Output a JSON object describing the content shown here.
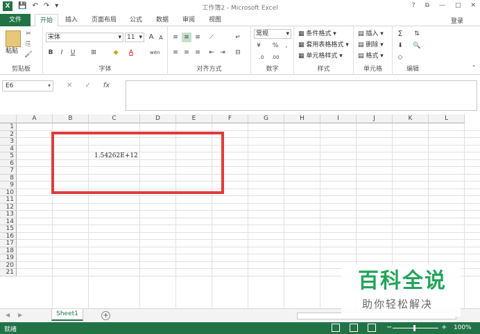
{
  "window": {
    "title": "工作簿2 - Microsoft Excel",
    "help": "?",
    "restore": "⧉",
    "minimize": "—",
    "maximize": "□",
    "close": "✕"
  },
  "quick_access": {
    "logo": "X",
    "save": "💾",
    "undo": "↶",
    "redo": "↷",
    "customize": "▾"
  },
  "tabs": [
    {
      "label": "文件"
    },
    {
      "label": "开始"
    },
    {
      "label": "插入"
    },
    {
      "label": "页面布局"
    },
    {
      "label": "公式"
    },
    {
      "label": "数据"
    },
    {
      "label": "审阅"
    },
    {
      "label": "视图"
    }
  ],
  "login": "登录",
  "ribbon": {
    "clipboard": {
      "label": "剪贴板",
      "paste": "粘贴"
    },
    "font": {
      "label": "字体",
      "font_name": "宋体",
      "font_size": "11",
      "grow": "A",
      "shrink": "A",
      "bold": "B",
      "italic": "I",
      "underline": "U",
      "font_color": "A",
      "phonetic": "wén"
    },
    "alignment": {
      "label": "对齐方式"
    },
    "number": {
      "label": "数字",
      "format": "常规",
      "percent": "%",
      "comma": ","
    },
    "styles": {
      "label": "样式",
      "conditional": "条件格式",
      "as_table": "套用表格格式",
      "cell_styles": "单元格样式"
    },
    "cells": {
      "label": "单元格",
      "insert": "插入",
      "delete": "删除",
      "format": "格式"
    },
    "editing": {
      "label": "编辑",
      "sum": "Σ"
    }
  },
  "formula_bar": {
    "name_box": "E6",
    "cancel": "✕",
    "enter": "✓",
    "fx": "fx",
    "content": ""
  },
  "columns": [
    "A",
    "B",
    "C",
    "D",
    "E",
    "F",
    "G",
    "H",
    "I",
    "J",
    "K",
    "L"
  ],
  "rows": [
    "1",
    "2",
    "3",
    "4",
    "5",
    "6",
    "7",
    "8",
    "9",
    "10",
    "11",
    "12",
    "13",
    "14",
    "15",
    "16",
    "17",
    "18",
    "19",
    "20",
    "21"
  ],
  "cells": {
    "C4": "1.54262E+12"
  },
  "sheets": [
    {
      "label": "Sheet1"
    }
  ],
  "add_sheet": "+",
  "status": {
    "text": "就绪",
    "zoom": "100%",
    "minus": "−",
    "plus": "+"
  },
  "watermark": {
    "title": "百科全说",
    "subtitle": "助你轻松解决"
  },
  "colors": {
    "excel_green": "#217346",
    "highlight_red": "#e03c3c",
    "watermark_green": "#22a45a"
  }
}
